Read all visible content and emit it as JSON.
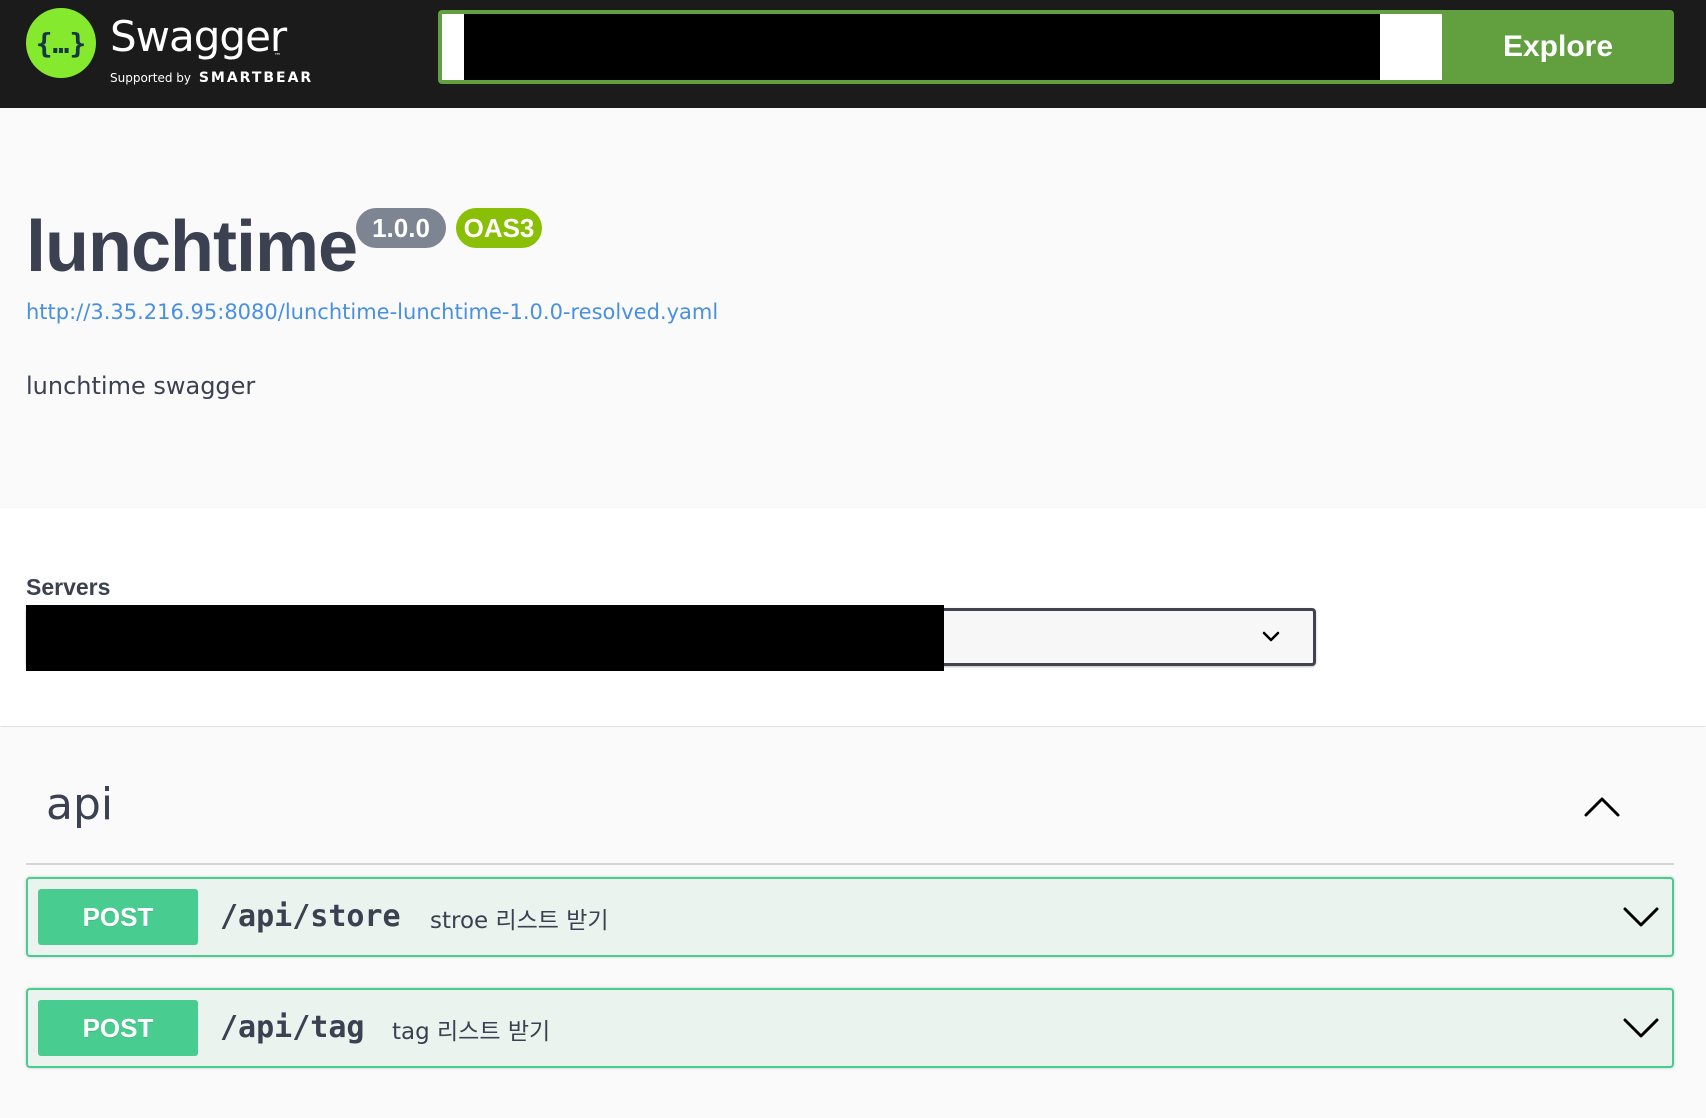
{
  "topbar": {
    "logo_text": "Swagger",
    "logo_supported_by": "Supported by",
    "logo_brand": "SMARTBEAR",
    "explore_label": "Explore",
    "brand_color": "#85ea2d",
    "explore_color": "#62a03f"
  },
  "info": {
    "title": "lunchtime",
    "version": "1.0.0",
    "oas_badge": "OAS3",
    "spec_url": "http://3.35.216.95:8080/lunchtime-lunchtime-1.0.0-resolved.yaml",
    "description": "lunchtime swagger"
  },
  "servers": {
    "label": "Servers",
    "icon": "chevron-down-icon"
  },
  "tag": {
    "name": "api",
    "icon": "chevron-up-icon",
    "operations": [
      {
        "method": "POST",
        "path": "/api/store",
        "summary": "stroe 리스트 받기"
      },
      {
        "method": "POST",
        "path": "/api/tag",
        "summary": "tag 리스트 받기"
      }
    ],
    "method_color": "#49cc90"
  }
}
